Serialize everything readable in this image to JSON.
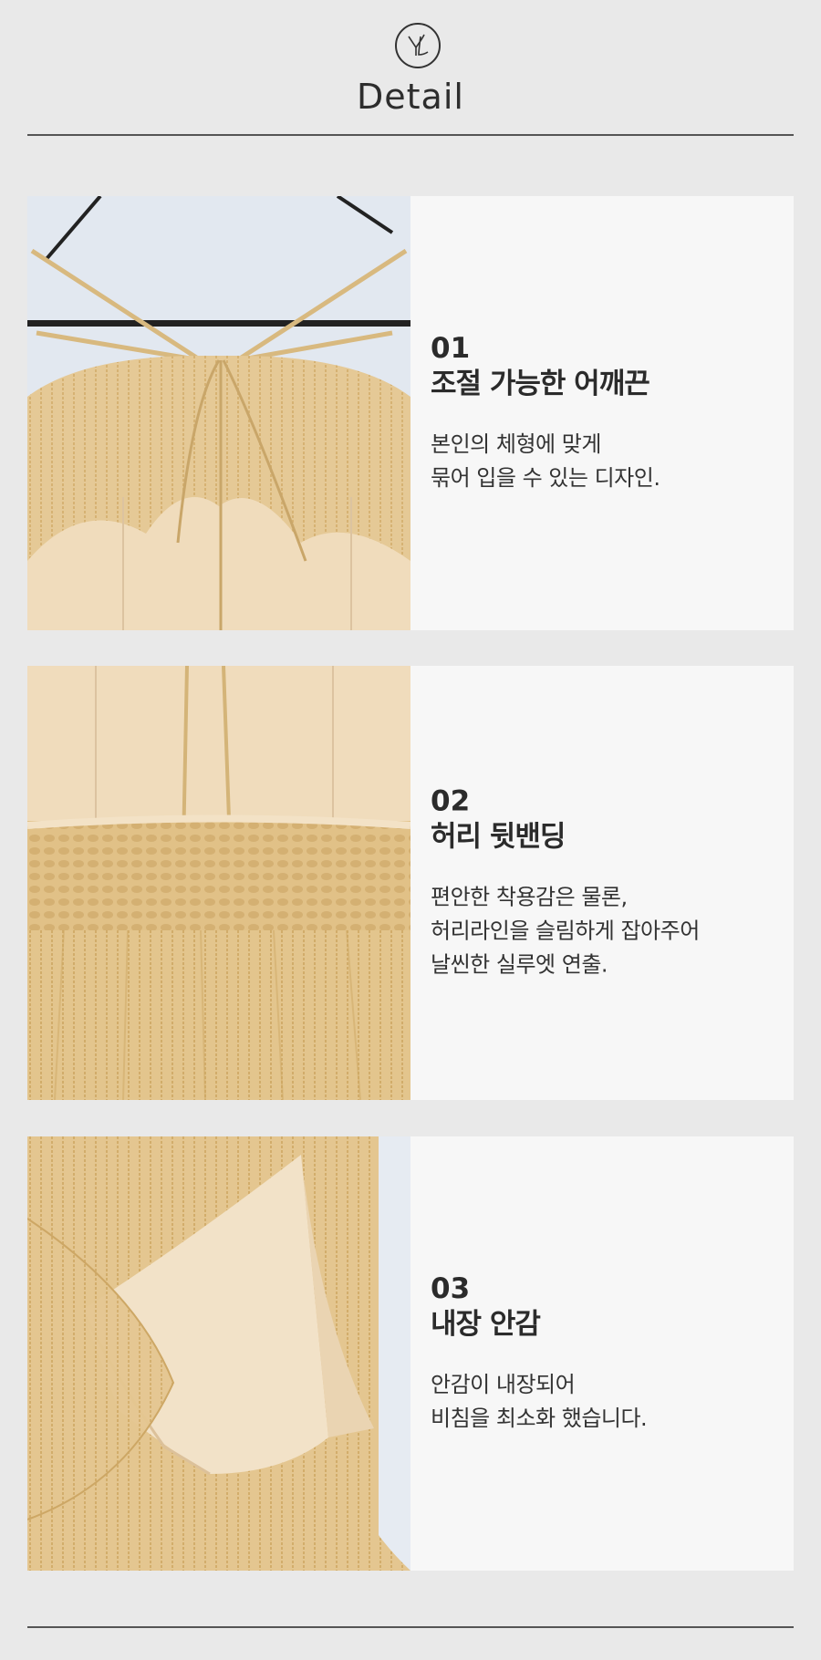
{
  "header": {
    "logo_icon": "yl-monogram-logo-icon",
    "title": "Detail"
  },
  "colors": {
    "background": "#e9e9e9",
    "panel": "#f7f7f7",
    "fabric": "#e3c58d",
    "lining": "#f1dcbd",
    "text": "#2f2f2f"
  },
  "sections": [
    {
      "number": "01",
      "title": "조절 가능한 어깨끈",
      "desc_lines": [
        "본인의 체형에 맞게",
        "묶어 입을 수 있는 디자인."
      ],
      "photo_icon": "shoulder-strap-detail-photo"
    },
    {
      "number": "02",
      "title": "허리 뒷밴딩",
      "desc_lines": [
        "편안한 착용감은 물론,",
        "허리라인을 슬림하게 잡아주어",
        "날씬한 실루엣 연출."
      ],
      "photo_icon": "waist-band-detail-photo"
    },
    {
      "number": "03",
      "title": "내장 안감",
      "desc_lines": [
        "안감이 내장되어",
        "비침을 최소화 했습니다."
      ],
      "photo_icon": "lining-detail-photo"
    }
  ]
}
